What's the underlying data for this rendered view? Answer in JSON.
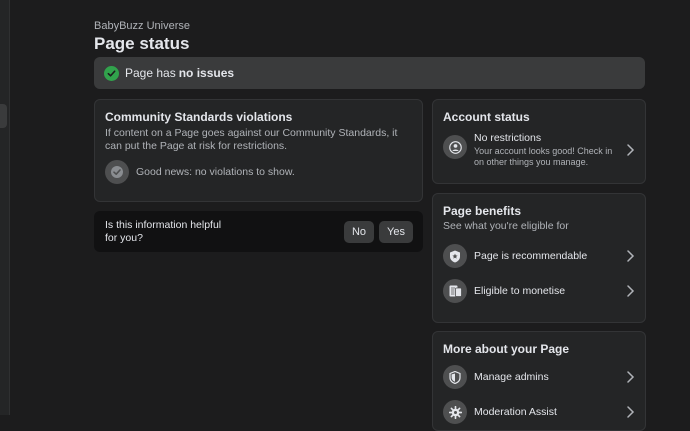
{
  "header": {
    "page_name": "BabyBuzz Universe",
    "title": "Page status"
  },
  "status_banner": {
    "prefix": "Page has",
    "emphasis": "no issues",
    "icon": "check-circle-icon",
    "color": "#31a24c"
  },
  "violations_card": {
    "title": "Community Standards violations",
    "description": "If content on a Page goes against our Community Standards, it can put the Page at risk for restrictions.",
    "good_news": "Good news: no violations to show."
  },
  "helpful": {
    "question": "Is this information helpful for you?",
    "no_label": "No",
    "yes_label": "Yes"
  },
  "account_status": {
    "title": "Account status",
    "item_title": "No restrictions",
    "item_sub": "Your account looks good! Check in on other things you manage."
  },
  "page_benefits": {
    "title": "Page benefits",
    "subtitle": "See what you're eligible for",
    "items": [
      {
        "label": "Page is recommendable",
        "icon": "shield-star-icon"
      },
      {
        "label": "Eligible to monetise",
        "icon": "document-money-icon"
      }
    ]
  },
  "more_about": {
    "title": "More about your Page",
    "items": [
      {
        "label": "Manage admins",
        "icon": "shield-icon"
      },
      {
        "label": "Moderation Assist",
        "icon": "gear-icon"
      }
    ]
  },
  "colors": {
    "background": "#1c1c1d",
    "card": "#242526",
    "banner": "#3a3b3c",
    "success": "#31a24c"
  }
}
